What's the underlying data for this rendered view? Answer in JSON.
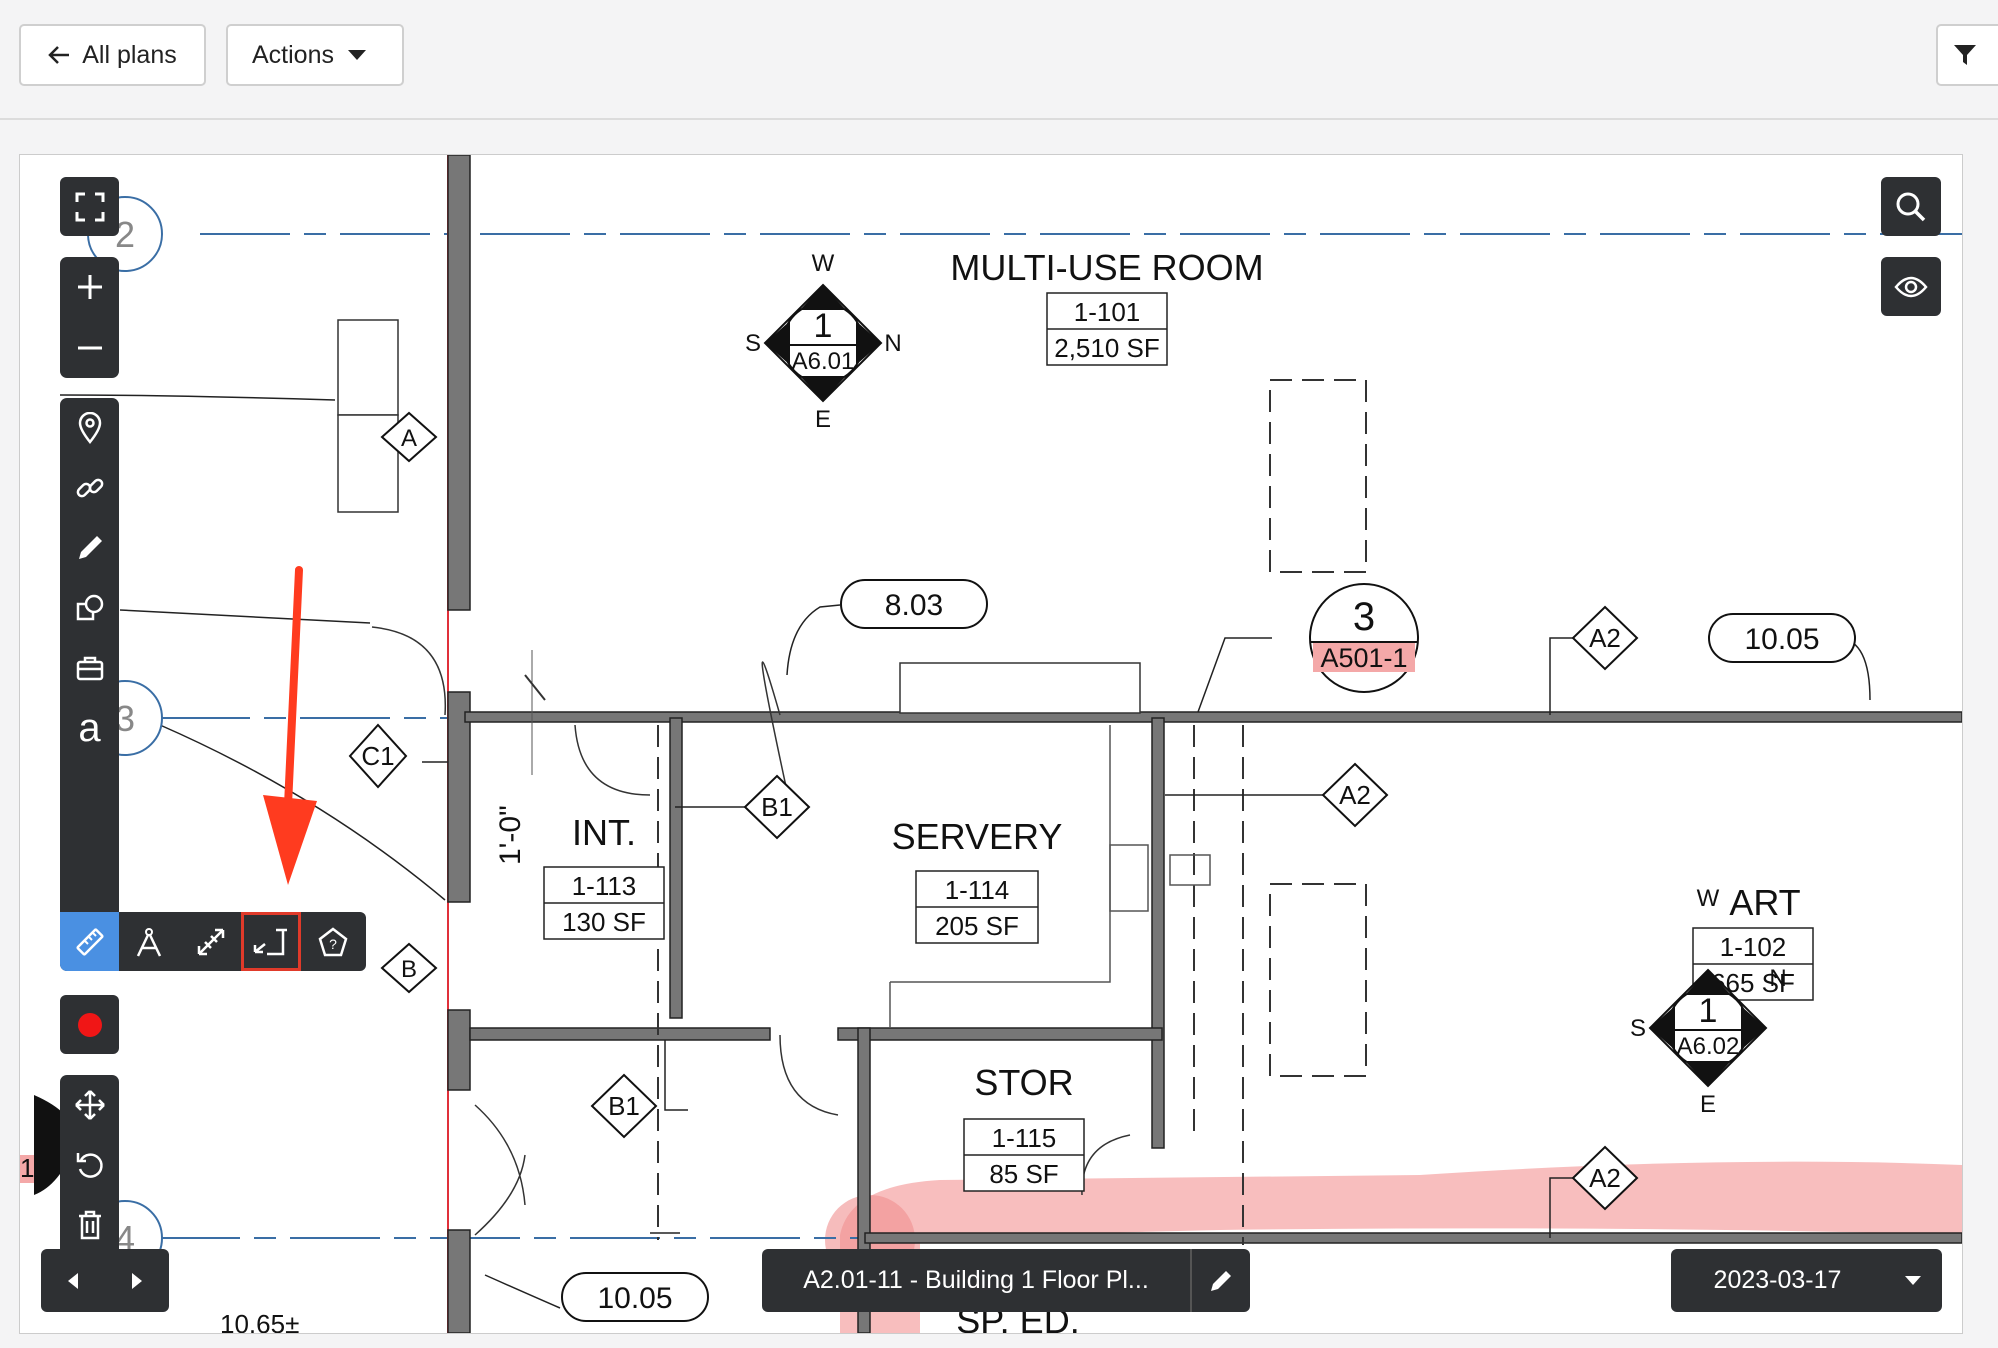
{
  "toolbar": {
    "back_label": "All plans",
    "actions_label": "Actions"
  },
  "plan": {
    "sheet_label": "A2.01-11 - Building 1 Floor Pl...",
    "date": "2023-03-17",
    "rooms": [
      {
        "name": "MULTI-USE ROOM",
        "number": "1-101",
        "area": "2,510 SF"
      },
      {
        "name": "INT.",
        "number": "1-113",
        "area": "130 SF"
      },
      {
        "name": "SERVERY",
        "number": "1-114",
        "area": "205 SF"
      },
      {
        "name": "STOR",
        "number": "1-115",
        "area": "85 SF"
      },
      {
        "name": "ART",
        "number": "1-102",
        "area": "665 SF"
      },
      {
        "name": "SP. ED.",
        "number": "",
        "area": ""
      }
    ],
    "grid_bubbles": [
      "2",
      "3",
      "4"
    ],
    "section_marker": {
      "number": "3",
      "sheet": "A501-1"
    },
    "elevation_markers": [
      {
        "number": "1",
        "sheet": "A6.01",
        "w": "W",
        "s": "S",
        "n": "N",
        "e": "E"
      },
      {
        "number": "1",
        "sheet": "A6.02",
        "w": "W",
        "s": "S",
        "n": "N",
        "e": "E"
      }
    ],
    "tags": [
      "A",
      "B",
      "C1",
      "B1",
      "B1",
      "A2",
      "A2",
      "A2",
      "A2"
    ],
    "ceiling_heights": [
      "8.03",
      "10.05",
      "10.05"
    ],
    "dimension": "1'-0\"",
    "partial_text": "10.65±",
    "edge_text": "1"
  },
  "tools": {
    "text_tool": "a",
    "icons": [
      "fullscreen-icon",
      "zoom-in-icon",
      "zoom-out-icon",
      "pin-icon",
      "link-icon",
      "pencil-icon",
      "shapes-icon",
      "toolbox-icon",
      "text-icon",
      "ruler-icon",
      "compass-icon",
      "diagonal-measure-icon",
      "area-measure-icon",
      "polygon-help-icon",
      "record-icon",
      "move-icon",
      "rotate-icon",
      "trash-icon",
      "search-icon",
      "eye-icon",
      "prev-arrow-icon",
      "next-arrow-icon",
      "edit-icon",
      "caret-down-icon",
      "filter-icon"
    ]
  },
  "colors": {
    "toolbar_bg": "#2e3033",
    "active_tool": "#4a90e2",
    "highlight": "#f7a8a8",
    "annotation_arrow": "#ff3b1f",
    "grid_line": "#3a6ea5"
  }
}
